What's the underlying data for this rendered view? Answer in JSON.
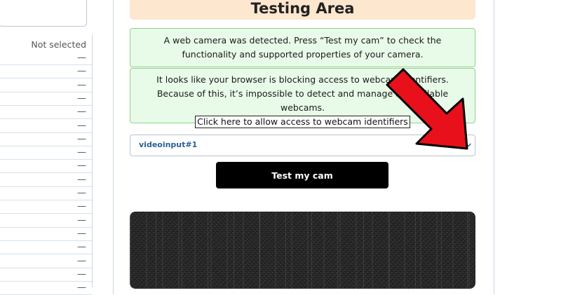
{
  "left_panel": {
    "status": "Not selected",
    "rows": [
      "—",
      "—",
      "—",
      "—",
      "—",
      "—",
      "—",
      "—",
      "—",
      "—",
      "—",
      "—",
      "—",
      "—",
      "—",
      "—",
      "—",
      "—"
    ]
  },
  "header": {
    "title": "Testing Area"
  },
  "alerts": {
    "detected": "A web camera was detected. Press “Test my cam” to check the functionality and supported properties of your camera.",
    "blocking": "It looks like your browser is blocking access to webcam identifiers. Because of this, it’s impossible to detect and manage all available webcams.",
    "allow_link": "Click here to allow access to webcam identifiers"
  },
  "camera_select": {
    "value": "videoinput#1"
  },
  "test_button": {
    "label": "Test my cam"
  },
  "icons": {
    "select_chevron": "chevron-down-icon",
    "annotation": "red-arrow-icon"
  },
  "colors": {
    "header_bg": "#fde7cf",
    "alert_bg": "#e8fbe8",
    "alert_border": "#8fd18f",
    "arrow": "#e8101a",
    "button": "#000000"
  }
}
